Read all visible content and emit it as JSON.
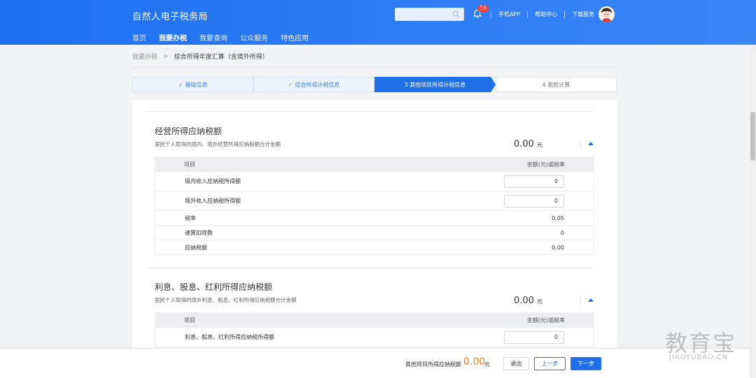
{
  "header": {
    "brand": "自然人电子税务局",
    "nav": [
      "首页",
      "我要办税",
      "我要查询",
      "公众服务",
      "特色应用"
    ],
    "active_nav": "我要办税",
    "notification_count": "16",
    "links": [
      "手机APP",
      "帮助中心",
      "下载服务"
    ]
  },
  "breadcrumb": {
    "root": "我要办税",
    "separator": ">",
    "current": "综合所得年度汇算（含境外所得）"
  },
  "steps": [
    {
      "label": "基础信息",
      "state": "done"
    },
    {
      "label": "综合所得计税信息",
      "state": "done"
    },
    {
      "label": "3  其他项目所得计税信息",
      "state": "active"
    },
    {
      "label": "4  税款计算",
      "state": "todo"
    }
  ],
  "section1": {
    "title": "经营所得应纳税额",
    "desc": "居民个人取得的境内、境外经营所得应纳税额合计金额",
    "amount": "0.00",
    "unit": "元",
    "col_item": "项目",
    "col_amount": "金额(元)或税率",
    "rows": [
      {
        "label": "境内收入应纳税所得额",
        "value": "0"
      },
      {
        "label": "境外收入应纳税所得额",
        "value": "0"
      },
      {
        "label": "税率",
        "value": "0.05"
      },
      {
        "label": "速算扣除数",
        "value": "0"
      },
      {
        "label": "应纳税额",
        "value": "0.00"
      }
    ]
  },
  "section2": {
    "title": "利息、股息、红利所得应纳税额",
    "desc": "居民个人取得的境外利息、股息、红利所得应纳税额合计金额",
    "amount": "0.00",
    "unit": "元",
    "col_item": "项目",
    "col_amount": "金额(元)或税率",
    "rows": [
      {
        "label": "利息、股息、红利所得应纳税所得额",
        "value": "0"
      }
    ]
  },
  "footer": {
    "label": "其他项目所得应纳税额",
    "amount": "0.00",
    "unit": "元",
    "exit": "退出",
    "prev": "上一步",
    "next": "下一步"
  },
  "watermark": {
    "cn": "教育宝",
    "en": "JIAOYUBAO.CN"
  },
  "colors": {
    "primary": "#1f6fe8",
    "accent": "#ff7a1a"
  }
}
